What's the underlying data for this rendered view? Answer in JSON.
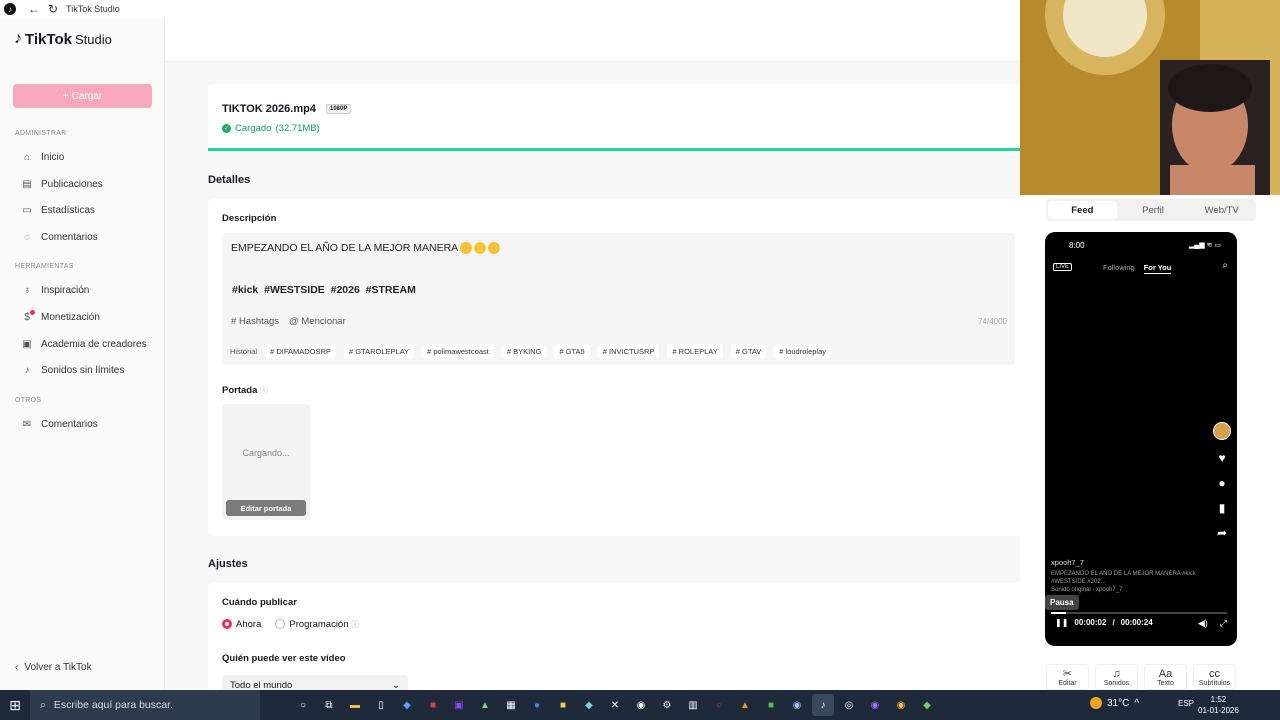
{
  "window": {
    "title": "TikTok Studio"
  },
  "sidebar": {
    "logo_brand": "TikTok",
    "logo_product": "Studio",
    "upload_label": "Cargar",
    "sections": {
      "admin": "ADMINISTRAR",
      "tools": "HERRAMIENTAS",
      "others": "OTROS"
    },
    "items": [
      {
        "label": "Inicio",
        "icon": "home-icon"
      },
      {
        "label": "Publicaciones",
        "icon": "posts-icon"
      },
      {
        "label": "Estadísticas",
        "icon": "analytics-icon"
      },
      {
        "label": "Comentarios",
        "icon": "comments-icon"
      },
      {
        "label": "Inspiración",
        "icon": "bulb-icon"
      },
      {
        "label": "Monetización",
        "icon": "money-icon"
      },
      {
        "label": "Academia de creadores",
        "icon": "academy-icon"
      },
      {
        "label": "Sonidos sin límites",
        "icon": "music-icon"
      },
      {
        "label": "Comentarios",
        "icon": "feedback-icon"
      }
    ],
    "back_label": "Volver a TikTok"
  },
  "upload": {
    "file_name": "TIKTOK 2026.mp4",
    "resolution": "1080P",
    "status": "Cargado",
    "size": "(32.71MB)",
    "progress": 1.0
  },
  "details": {
    "title": "Detalles",
    "description_label": "Descripción",
    "description_text": "EMPEZANDO EL AÑO DE LA MEJOR MANERA",
    "description_tags": "#kick  #WESTSIDE  #2026  #STREAM",
    "hashtags_label": "Hashtags",
    "mention_label": "Mencionar",
    "char_count": "74/4000",
    "history_label": "Historial",
    "history_tags": [
      "# DIFAMADOSRP",
      "# GTAROLEPLAY",
      "# polimawestcoast",
      "# BYKING",
      "# GTA5",
      "# INVICTUSRP",
      "# ROLEPLAY",
      "# GTAV",
      "# loudroleplay"
    ],
    "cover_label": "Portada",
    "cover_loading": "Cargando...",
    "cover_edit": "Editar portada"
  },
  "settings": {
    "title": "Ajustes",
    "when_label": "Cuándo publicar",
    "option_now": "Ahora",
    "option_schedule": "Programación",
    "who_label": "Quién puede ver este vídeo",
    "who_value": "Todo el mundo"
  },
  "preview": {
    "tabs": [
      "Feed",
      "Perfil",
      "Web/TV"
    ],
    "active_tab": "Feed",
    "phone_time": "8:00",
    "feed_following": "Following",
    "feed_foryou": "For You",
    "live_label": "LIVE",
    "username": "xpooh7_7",
    "caption": "EMPEZANDO EL AÑO DE LA MEJOR MANERA #kick #WESTSIDE #202...",
    "sound": "Sonido original - xpooh7_7",
    "tooltip": "Pausa",
    "current_time": "00:00:02",
    "total_time": "00:00:24",
    "playback_progress": 0.083,
    "tools": [
      {
        "label": "Editar",
        "icon": "scissors-icon",
        "glyph": "✂"
      },
      {
        "label": "Sonidos",
        "icon": "music-note-icon",
        "glyph": "♫"
      },
      {
        "label": "Texto",
        "icon": "text-icon",
        "glyph": "Aa"
      },
      {
        "label": "Subtítulos",
        "icon": "captions-icon",
        "glyph": "cc"
      }
    ]
  },
  "taskbar": {
    "search_placeholder": "Escribe aquí para buscar.",
    "temperature": "31°C",
    "language": "ESP",
    "time": "1:52",
    "date": "01-01-2026"
  },
  "colors": {
    "accent": "#fe2c55",
    "upload_button": "#f7a8bd",
    "success": "#1ea862",
    "progress": "#20d5a3"
  }
}
